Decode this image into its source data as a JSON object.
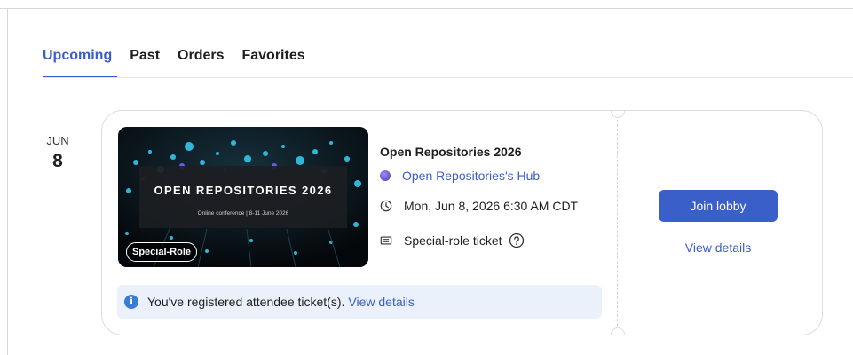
{
  "tabs": [
    {
      "label": "Upcoming",
      "active": true
    },
    {
      "label": "Past",
      "active": false
    },
    {
      "label": "Orders",
      "active": false
    },
    {
      "label": "Favorites",
      "active": false
    }
  ],
  "event": {
    "month": "JUN",
    "day": "8",
    "thumbnail": {
      "title": "OPEN REPOSITORIES 2026",
      "subtitle": "Online conference | 8-11 June 2026",
      "badge": "Special-Role"
    },
    "title": "Open Repositories 2026",
    "host": "Open Repositories's Hub",
    "datetime": "Mon, Jun 8, 2026 6:30 AM CDT",
    "ticket": "Special-role ticket",
    "notice": {
      "text": "You've registered attendee ticket(s).",
      "link": "View details"
    },
    "actions": {
      "join": "Join lobby",
      "view_details": "View details"
    }
  },
  "colors": {
    "accent": "#3a5fc8",
    "info_bg": "#eaf1fb"
  }
}
